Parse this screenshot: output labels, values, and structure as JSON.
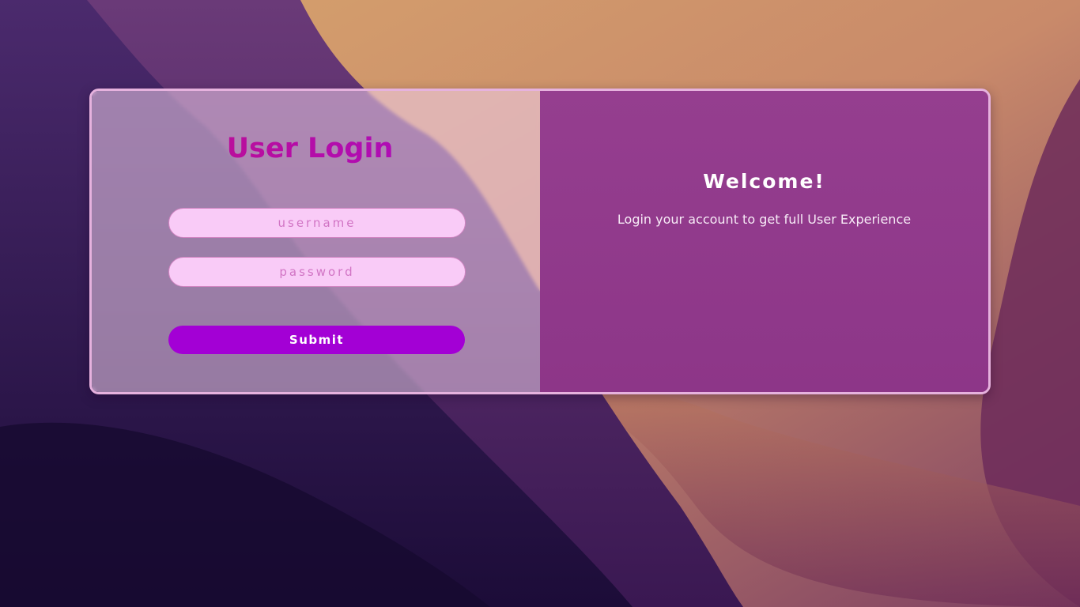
{
  "login": {
    "title": "User Login",
    "username_placeholder": "username",
    "password_placeholder": "password",
    "submit_label": "Submit"
  },
  "welcome": {
    "title": "Welcome!",
    "subtitle": "Login your account to get full User Experience"
  },
  "colors": {
    "accent": "#a300d5",
    "title_gradient_start": "#c20f88",
    "title_gradient_end": "#a70bc8",
    "welcome_panel": "#923b8d",
    "input_background": "#f9cbf7"
  }
}
